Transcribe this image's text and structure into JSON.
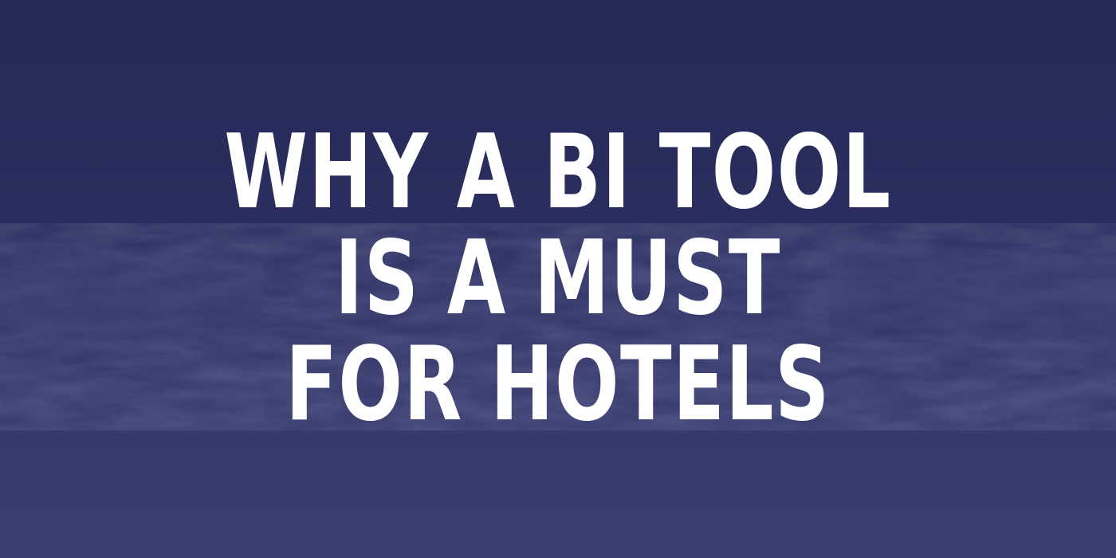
{
  "headline": {
    "lines": [
      "WHY A BI TOOL",
      "IS A MUST",
      "FOR HOTELS"
    ]
  },
  "colors": {
    "background_top": "#262a58",
    "background_bottom": "#3b3f70",
    "wave_tone": "#3a3e72",
    "text": "#ffffff"
  },
  "icons": {
    "background": "ocean-waves-photo"
  }
}
